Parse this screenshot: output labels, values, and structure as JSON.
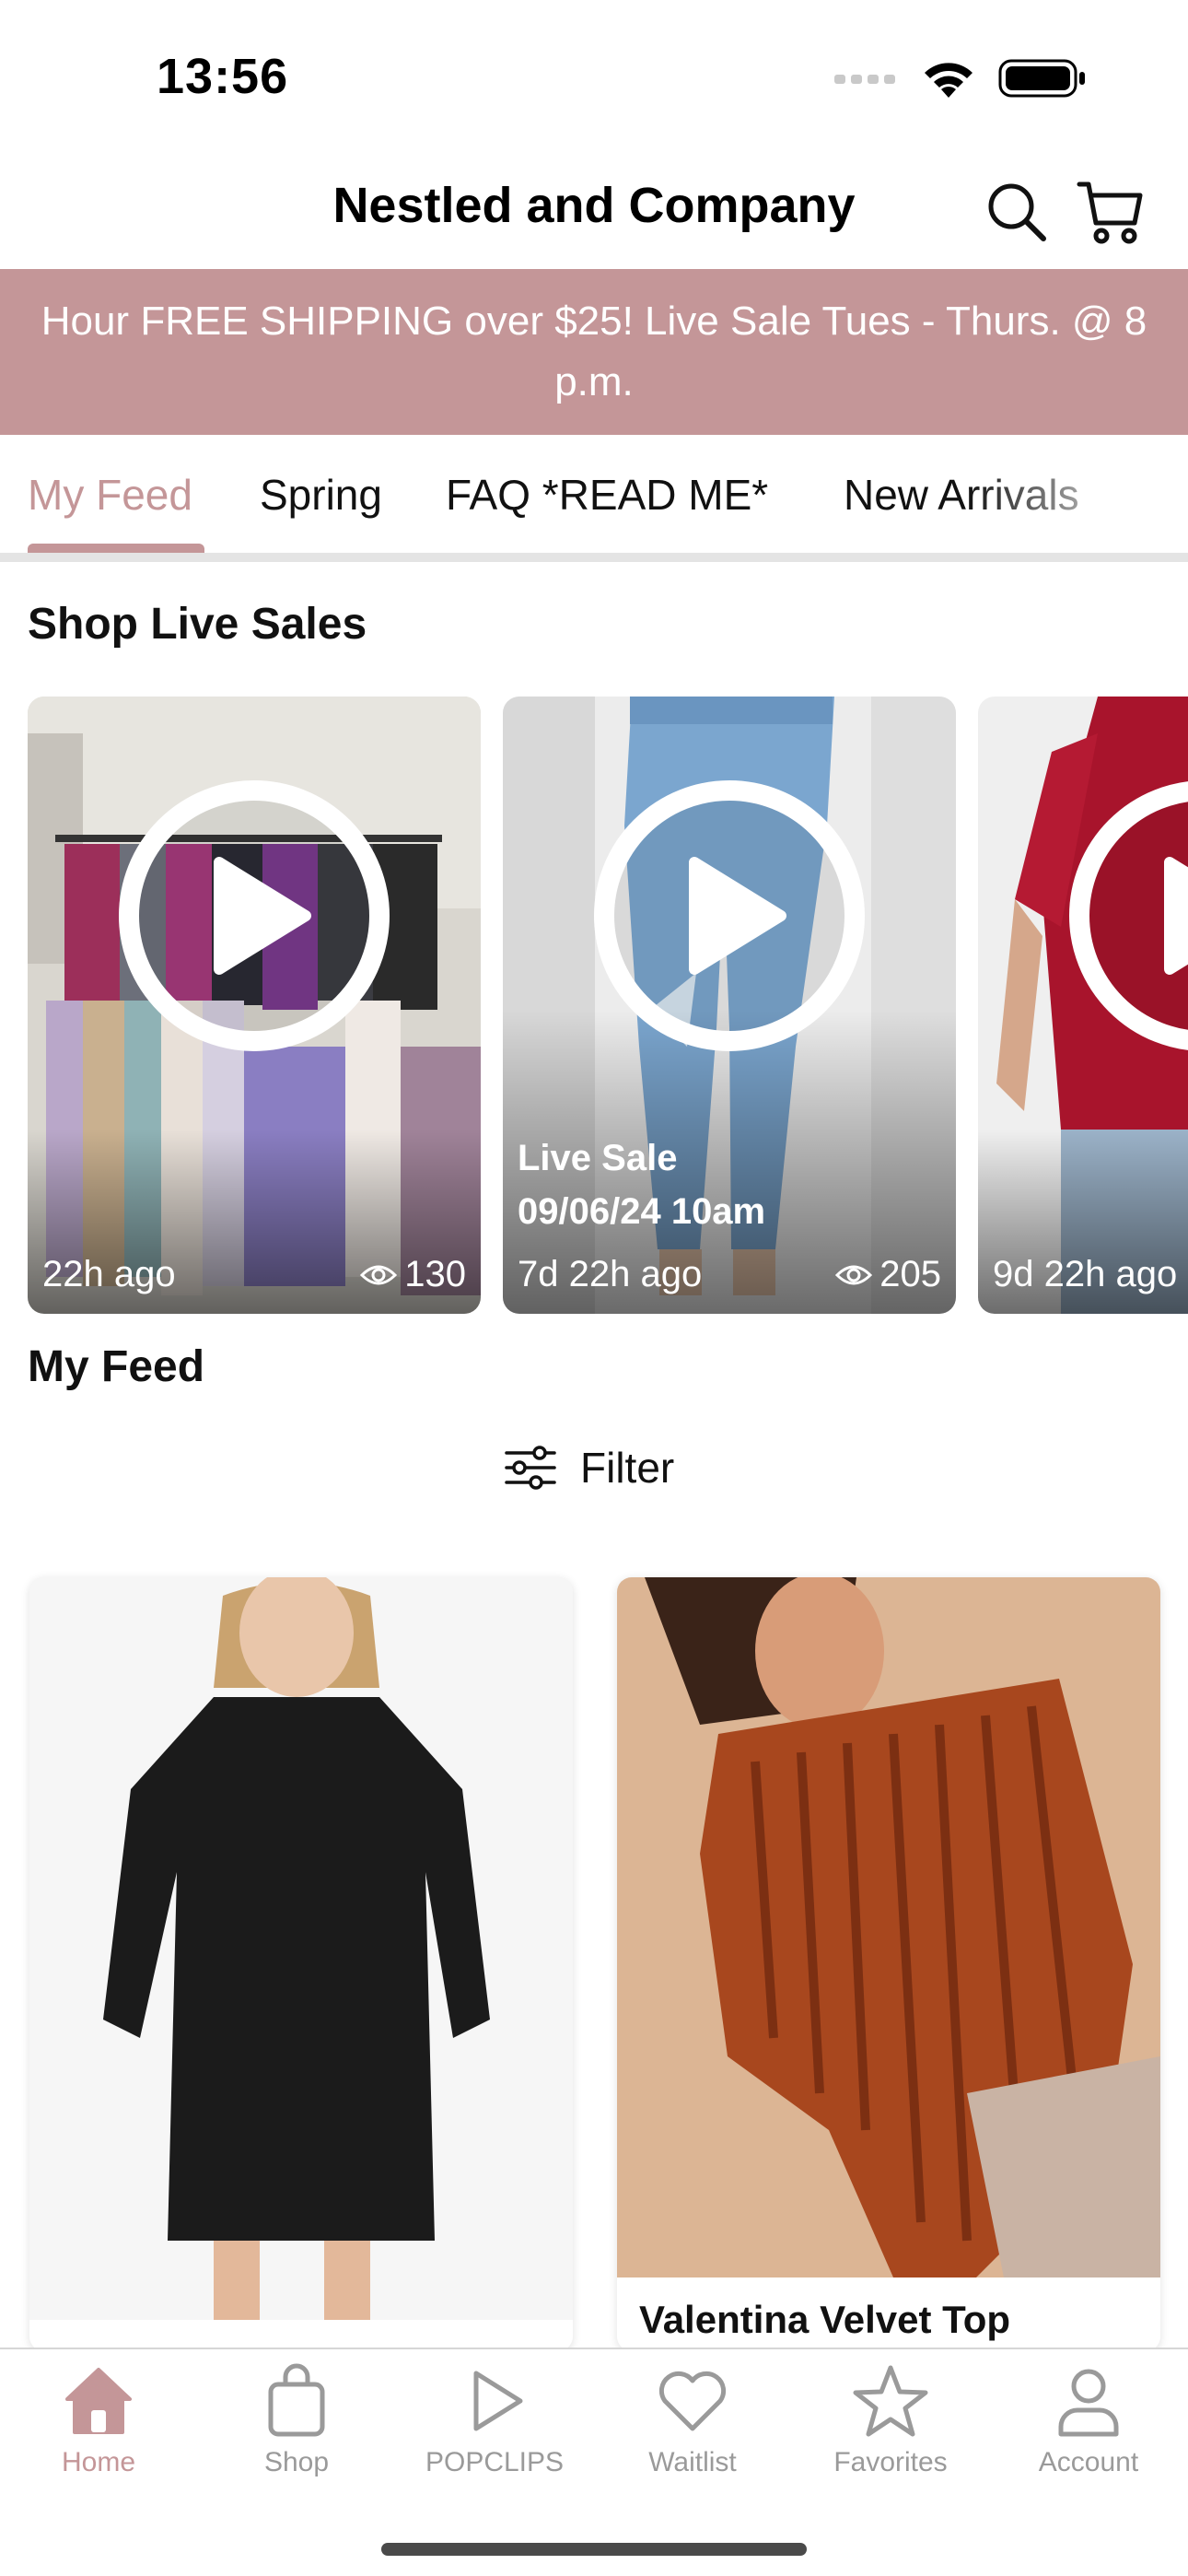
{
  "status_bar": {
    "time": "13:56",
    "icons": [
      "cellular-signal-icon",
      "wifi-icon",
      "battery-icon"
    ]
  },
  "header": {
    "title": "Nestled and Company",
    "icons": [
      "search-icon",
      "cart-icon"
    ]
  },
  "promo": {
    "text": "Hour FREE SHIPPING over $25! Live Sale Tues - Thurs. @ 8 p.m."
  },
  "tabs": [
    {
      "label": "My Feed",
      "active": true
    },
    {
      "label": "Spring"
    },
    {
      "label": "FAQ *READ ME*"
    },
    {
      "label": "New Arrivals"
    }
  ],
  "live_sales": {
    "title": "Shop Live Sales",
    "cards": [
      {
        "title": "",
        "time": "22h ago",
        "views": "130"
      },
      {
        "title_line1": "Live Sale",
        "title_line2": "09/06/24 10am",
        "time": "7d 22h ago",
        "views": "205"
      },
      {
        "title": "",
        "time": "9d 22h ago",
        "views": ""
      }
    ]
  },
  "feed": {
    "title": "My Feed",
    "filter_label": "Filter",
    "products": [
      {
        "name": ""
      },
      {
        "name": "Valentina Velvet Top"
      }
    ]
  },
  "bottom_nav": [
    {
      "label": "Home",
      "icon": "home-icon",
      "active": true
    },
    {
      "label": "Shop",
      "icon": "shopping-bag-icon"
    },
    {
      "label": "POPCLIPS",
      "icon": "play-icon"
    },
    {
      "label": "Waitlist",
      "icon": "heart-icon"
    },
    {
      "label": "Favorites",
      "icon": "star-icon"
    },
    {
      "label": "Account",
      "icon": "person-icon"
    }
  ],
  "colors": {
    "accent": "#c49698",
    "promo_bg": "#c49698",
    "text": "#111111",
    "muted": "#9a9a9a"
  }
}
